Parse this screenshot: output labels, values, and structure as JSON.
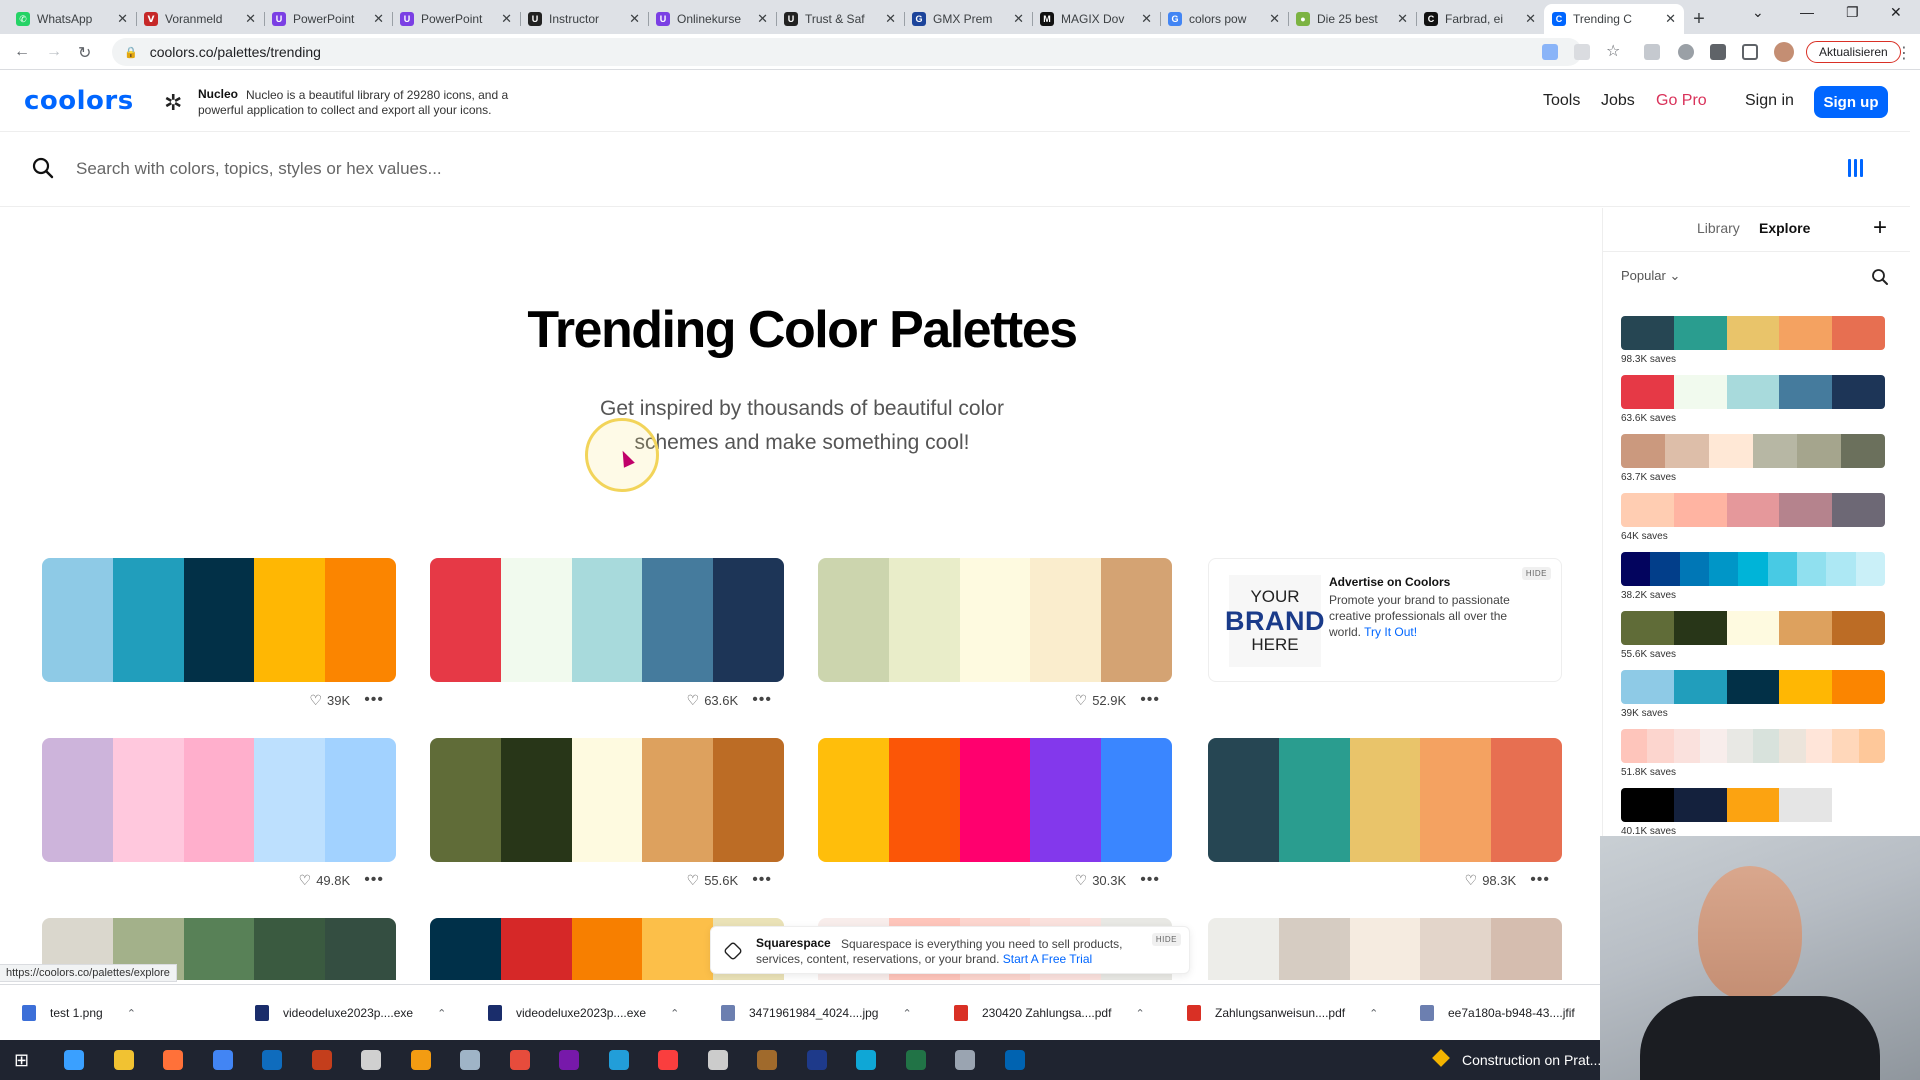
{
  "browser": {
    "tabs": [
      {
        "label": "WhatsApp",
        "color": "#25d366",
        "glyph": "✆"
      },
      {
        "label": "Voranmeld",
        "color": "#c62828",
        "glyph": "Ⅴ"
      },
      {
        "label": "PowerPoint",
        "color": "#7b3fe4",
        "glyph": "U"
      },
      {
        "label": "PowerPoint",
        "color": "#7b3fe4",
        "glyph": "U"
      },
      {
        "label": "Instructor",
        "color": "#222222",
        "glyph": "U"
      },
      {
        "label": "Onlinekurse",
        "color": "#7b3fe4",
        "glyph": "U"
      },
      {
        "label": "Trust & Saf",
        "color": "#222222",
        "glyph": "U"
      },
      {
        "label": "GMX Prem",
        "color": "#1c449b",
        "glyph": "G"
      },
      {
        "label": "MAGIX Dov",
        "color": "#111111",
        "glyph": "M"
      },
      {
        "label": "colors pow",
        "color": "#4285f4",
        "glyph": "G"
      },
      {
        "label": "Die 25 best",
        "color": "#7cb342",
        "glyph": "●"
      },
      {
        "label": "Farbrad, ei",
        "color": "#111111",
        "glyph": "C"
      },
      {
        "label": "Trending C",
        "color": "#0066ff",
        "glyph": "C",
        "active": true
      }
    ],
    "tab_close": "✕",
    "new_tab": "+",
    "url": "coolors.co/palettes/trending",
    "update_label": "Aktualisieren",
    "status_url": "https://coolors.co/palettes/explore"
  },
  "header": {
    "logo": "coolors",
    "sponsor_name": "Nucleo",
    "sponsor_text": "Nucleo is a beautiful library of 29280 icons, and a",
    "sponsor_text2": "powerful application to collect and export all your icons.",
    "nav": {
      "tools": "Tools",
      "jobs": "Jobs",
      "gopro": "Go Pro",
      "signin": "Sign in",
      "signup": "Sign up"
    }
  },
  "search": {
    "placeholder": "Search with colors, topics, styles or hex values..."
  },
  "hero": {
    "title": "Trending Color Palettes",
    "subtitle": "Get inspired by thousands of beautiful color schemes and make something cool!"
  },
  "palettes": [
    {
      "colors": [
        "#8ecae6",
        "#219ebc",
        "#023047",
        "#ffb703",
        "#fb8500"
      ],
      "likes": "39K"
    },
    {
      "colors": [
        "#e63946",
        "#f1faee",
        "#a8dadc",
        "#457b9d",
        "#1d3557"
      ],
      "likes": "63.6K"
    },
    {
      "colors": [
        "#ccd5ae",
        "#e9edc9",
        "#fefae0",
        "#faedcd",
        "#d4a373"
      ],
      "likes": "52.9K"
    },
    {
      "colors": [
        "#cdb4db",
        "#ffc8dd",
        "#ffafcc",
        "#bde0fe",
        "#a2d2ff"
      ],
      "likes": "49.8K"
    },
    {
      "colors": [
        "#606c38",
        "#283618",
        "#fefae0",
        "#dda15e",
        "#bc6c25"
      ],
      "likes": "55.6K"
    },
    {
      "colors": [
        "#ffbe0b",
        "#fb5607",
        "#ff006e",
        "#8338ec",
        "#3a86ff"
      ],
      "likes": "30.3K"
    },
    {
      "colors": [
        "#264653",
        "#2a9d8f",
        "#e9c46a",
        "#f4a261",
        "#e76f51"
      ],
      "likes": "98.3K"
    },
    {
      "colors": [
        "#dad7cd",
        "#a3b18a",
        "#588157",
        "#3a5a40",
        "#344e41"
      ],
      "likes": ""
    },
    {
      "colors": [
        "#003049",
        "#d62828",
        "#f77f00",
        "#fcbf49",
        "#eae2b7"
      ],
      "likes": ""
    },
    {
      "colors": [
        "#f8edeb",
        "#fec5bb",
        "#fcd5ce",
        "#fae1dd",
        "#e8e8e4"
      ],
      "likes": ""
    },
    {
      "colors": [
        "#edede9",
        "#d6ccc2",
        "#f5ebe0",
        "#e3d5ca",
        "#d5bdaf"
      ],
      "likes": ""
    }
  ],
  "ad": {
    "brand_line1": "YOUR",
    "brand_line2": "BRAND",
    "brand_line3": "HERE",
    "title": "Advertise on Coolors",
    "text": "Promote your brand to passionate creative professionals all over the world.",
    "link": "Try It Out!",
    "hide": "HIDE"
  },
  "squarespace": {
    "title": "Squarespace",
    "text": "Squarespace is everything you need to sell products,",
    "text2": "services, content, reservations, or your brand.",
    "link": "Start A Free Trial",
    "hide": "HIDE"
  },
  "sidebar": {
    "tab_library": "Library",
    "tab_explore": "Explore",
    "filter": "Popular",
    "palettes": [
      {
        "colors": [
          "#264653",
          "#2a9d8f",
          "#e9c46a",
          "#f4a261",
          "#e76f51"
        ],
        "saves": "98.3K saves"
      },
      {
        "colors": [
          "#e63946",
          "#f1faee",
          "#a8dadc",
          "#457b9d",
          "#1d3557"
        ],
        "saves": "63.6K saves"
      },
      {
        "colors": [
          "#cb997e",
          "#ddbea9",
          "#ffe8d6",
          "#b7b7a4",
          "#a5a58d",
          "#6b705c"
        ],
        "saves": "63.7K saves"
      },
      {
        "colors": [
          "#ffcdb2",
          "#ffb4a2",
          "#e5989b",
          "#b5838d",
          "#6d6875"
        ],
        "saves": "64K saves"
      },
      {
        "colors": [
          "#03045e",
          "#023e8a",
          "#0077b6",
          "#0096c7",
          "#00b4d8",
          "#48cae4",
          "#90e0ef",
          "#ade8f4",
          "#caf0f8"
        ],
        "saves": "38.2K saves"
      },
      {
        "colors": [
          "#606c38",
          "#283618",
          "#fefae0",
          "#dda15e",
          "#bc6c25"
        ],
        "saves": "55.6K saves"
      },
      {
        "colors": [
          "#8ecae6",
          "#219ebc",
          "#023047",
          "#ffb703",
          "#fb8500"
        ],
        "saves": "39K saves"
      },
      {
        "colors": [
          "#fec5bb",
          "#fcd5ce",
          "#fae1dd",
          "#f8edeb",
          "#e8e8e4",
          "#d8e2dc",
          "#ece4db",
          "#ffe5d9",
          "#ffd7ba",
          "#fec89a"
        ],
        "saves": "51.8K saves"
      },
      {
        "colors": [
          "#000000",
          "#14213d",
          "#fca311",
          "#e5e5e5",
          "#ffffff"
        ],
        "saves": "40.1K saves"
      }
    ]
  },
  "downloads": [
    {
      "name": "test 1.png",
      "color": "#3c6fd8"
    },
    {
      "name": "videodeluxe2023p....exe",
      "color": "#1a2d6b"
    },
    {
      "name": "videodeluxe2023p....exe",
      "color": "#1a2d6b"
    },
    {
      "name": "3471961984_4024....jpg",
      "color": "#6c7fb0"
    },
    {
      "name": "230420 Zahlungsa....pdf",
      "color": "#d93025"
    },
    {
      "name": "Zahlungsanweisun....pdf",
      "color": "#d93025"
    },
    {
      "name": "ee7a180a-b948-43....jfif",
      "color": "#6c7fb0"
    }
  ],
  "taskbar": {
    "construction_label": "Construction on Prat...",
    "apps": [
      "#3aa0ff",
      "#f1c232",
      "#ff7139",
      "#4285f4",
      "#0f6cbd",
      "#c43e1c",
      "#d0d0d0",
      "#f39c12",
      "#9fb4c7",
      "#e74c3c",
      "#7719aa",
      "#229ed9",
      "#fa3e3e",
      "#cccccc",
      "#a06a2c",
      "#1e3a8a",
      "#0fa7d6",
      "#217346",
      "#9aa4b1",
      "#0063b1"
    ]
  }
}
